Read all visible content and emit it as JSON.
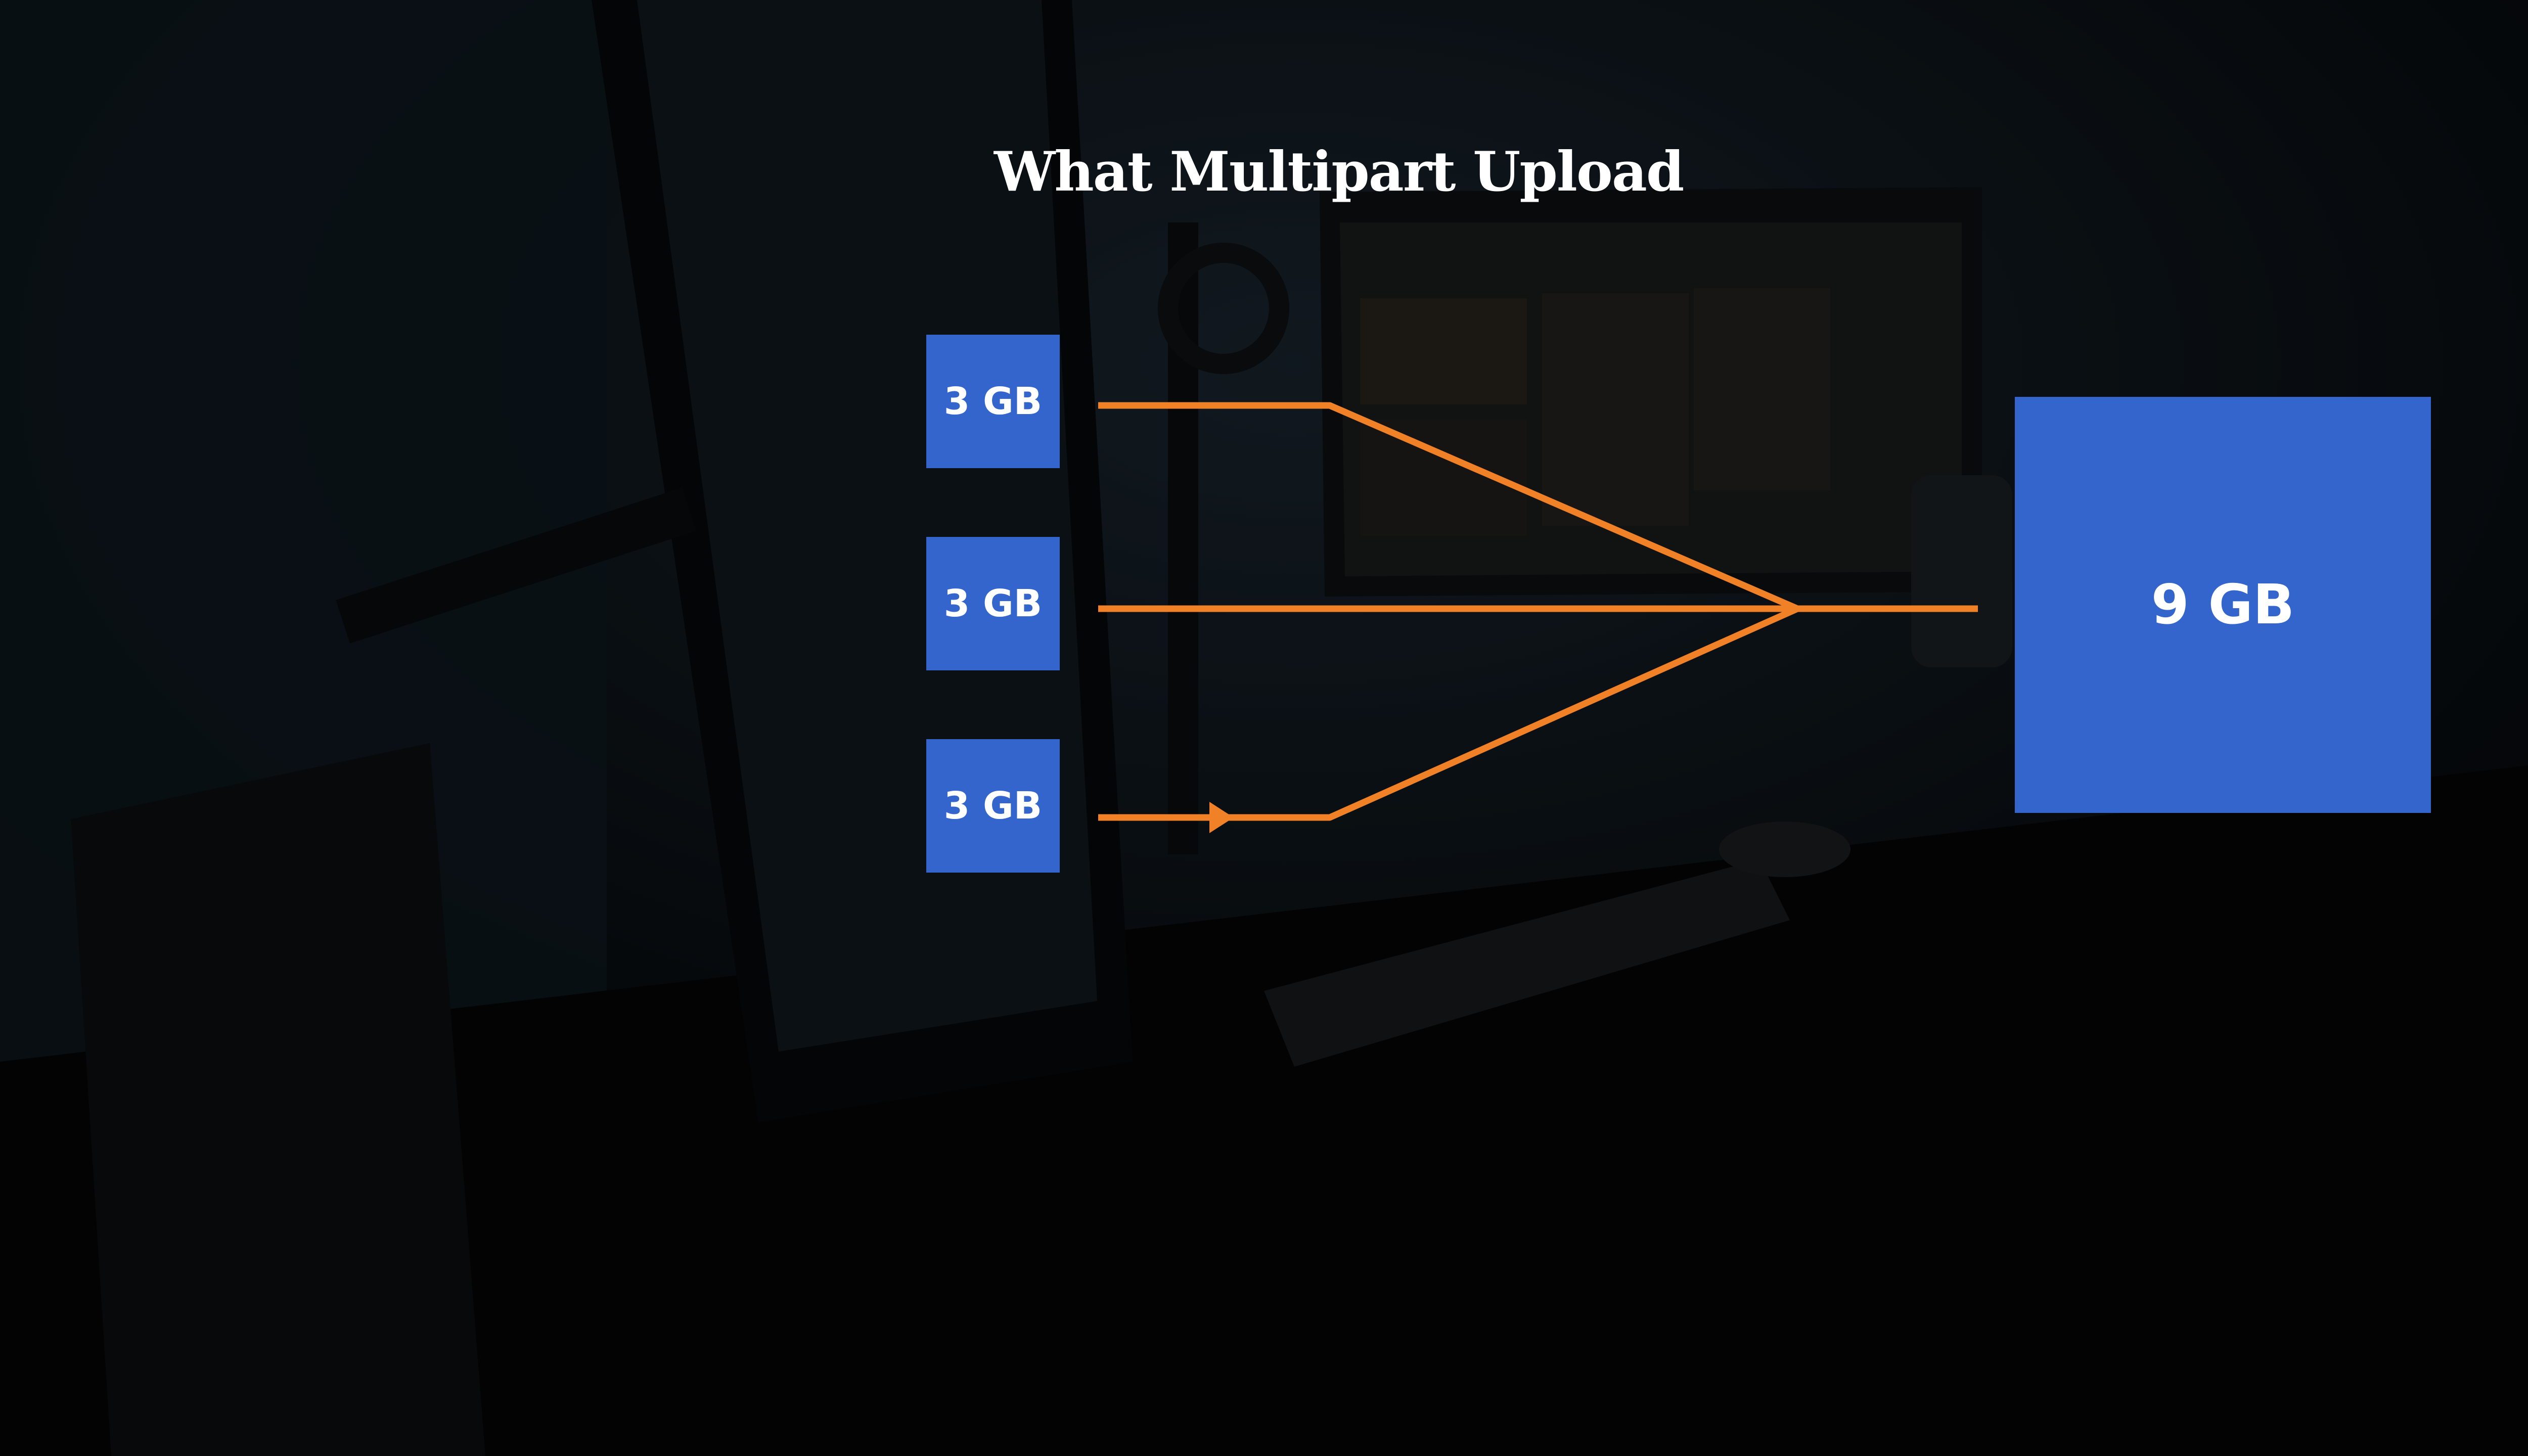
{
  "title": "What Multipart Upload",
  "parts": [
    {
      "label": "3 GB"
    },
    {
      "label": "3 GB"
    },
    {
      "label": "3 GB"
    }
  ],
  "result": {
    "label": "9 GB"
  },
  "colors": {
    "box": "#3465cd",
    "connector": "#f08127",
    "text": "#ffffff",
    "background": "#0b0f14"
  }
}
